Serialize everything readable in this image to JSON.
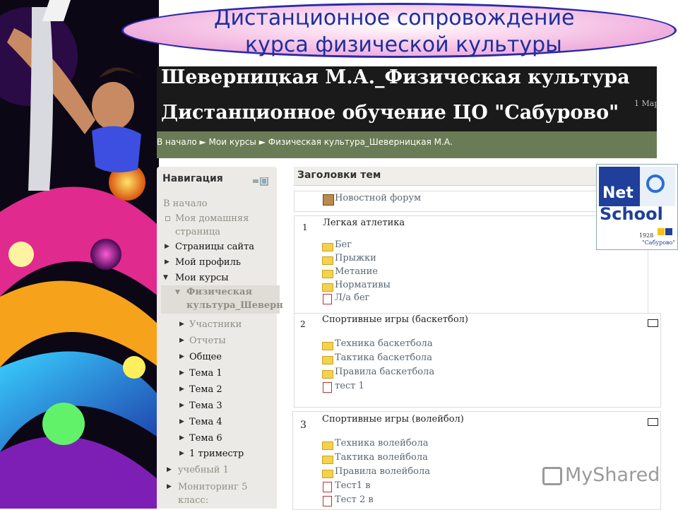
{
  "slide": {
    "title_line1": "Дистанционное сопровождение",
    "title_line2": "курса физической культуры"
  },
  "header": {
    "line1": "Шеверницкая М.А._Физическая культура",
    "line2": "Дистанционное обучение ЦО \"Сабурово\"",
    "right_fragment": "1 Мар"
  },
  "breadcrumb": "В начало ► Мои курсы ► Физическая культура_Шеверницкая М.А.",
  "nav": {
    "title": "Навигация",
    "home": "В начало",
    "my_home": "Моя домашняя страница",
    "my_home_l1": "Моя домашняя",
    "my_home_l2": "страница",
    "site_pages": "Страницы сайта",
    "my_profile": "Мой профиль",
    "my_courses": "Мои курсы",
    "course_l1": "Физическая",
    "course_l2": "культура_Шеверн",
    "participants": "Участники",
    "reports": "Отчеты",
    "general": "Общее",
    "topics": [
      "Тема 1",
      "Тема 2",
      "Тема 3",
      "Тема 4",
      "Тема 6"
    ],
    "trimester": "1 триместр",
    "academic": "учебный 1",
    "monitoring_l1": "Мониторинг 5",
    "monitoring_l2": "класс:"
  },
  "content": {
    "section_header": "Заголовки тем",
    "forum": "Новостной форум",
    "sections": [
      {
        "num": "1",
        "title": "Легкая атлетика",
        "items": [
          {
            "type": "folder",
            "label": "Бег"
          },
          {
            "type": "folder",
            "label": "Прыжки"
          },
          {
            "type": "folder",
            "label": "Метание"
          },
          {
            "type": "folder",
            "label": "Нормативы"
          },
          {
            "type": "quiz",
            "label": "Л/а бег"
          }
        ]
      },
      {
        "num": "2",
        "title": "Спортивные игры (баскетбол)",
        "items": [
          {
            "type": "folder",
            "label": "Техника баскетбола"
          },
          {
            "type": "folder",
            "label": "Тактика баскетбола"
          },
          {
            "type": "folder",
            "label": "Правила баскетбола"
          },
          {
            "type": "quiz",
            "label": "тест 1"
          }
        ]
      },
      {
        "num": "3",
        "title": "Спортивные игры (волейбол)",
        "items": [
          {
            "type": "folder",
            "label": "Техника волейбола"
          },
          {
            "type": "folder",
            "label": "Тактика волейбола"
          },
          {
            "type": "folder",
            "label": "Правила волейбола"
          },
          {
            "type": "quiz",
            "label": "Тест1 в"
          },
          {
            "type": "quiz",
            "label": "Тест 2 в"
          }
        ]
      }
    ]
  },
  "logo": {
    "net": "Net",
    "school": "School",
    "year": "1928",
    "name": "\"Сабурово\""
  },
  "watermark": "MyShared",
  "colors": {
    "title_blue": "#1d2f9e",
    "header_bg": "#1a1a1a",
    "breadcrumb_bg": "#6a7c55",
    "nav_bg": "#eceae6",
    "folder_yellow": "#f4d24e"
  }
}
